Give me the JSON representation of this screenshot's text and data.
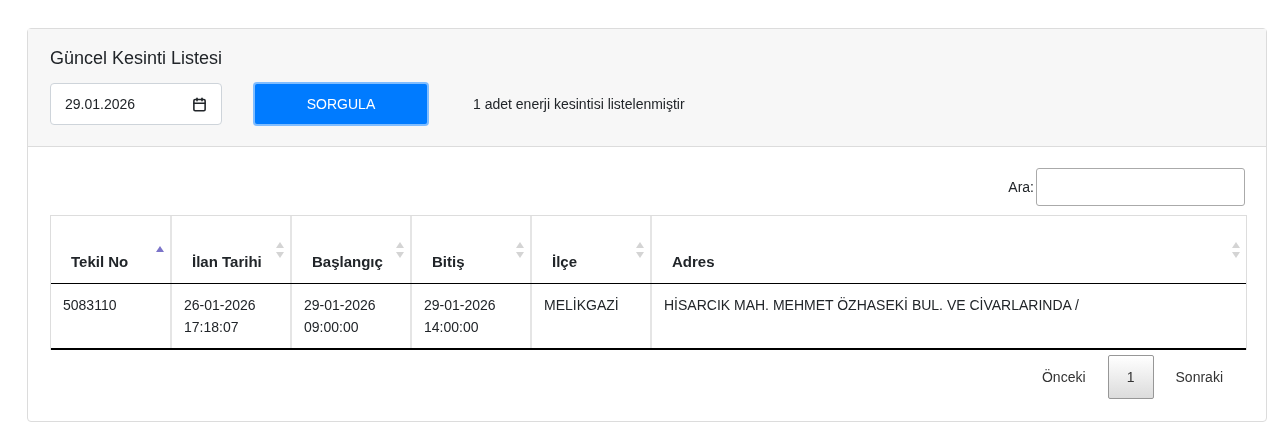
{
  "panel": {
    "title": "Güncel Kesinti Listesi",
    "date_value": "29.01.2026",
    "query_button": "SORGULA",
    "result_text": "1 adet enerji kesintisi listelenmiştir"
  },
  "search": {
    "label": "Ara:"
  },
  "table": {
    "columns": [
      {
        "label": "Tekil No",
        "sorted": true
      },
      {
        "label": "İlan Tarihi",
        "sorted": false
      },
      {
        "label": "Başlangıç",
        "sorted": false
      },
      {
        "label": "Bitiş",
        "sorted": false
      },
      {
        "label": "İlçe",
        "sorted": false
      },
      {
        "label": "Adres",
        "sorted": false
      }
    ],
    "rows": [
      {
        "cells": [
          [
            "5083110"
          ],
          [
            "26-01-2026",
            "17:18:07"
          ],
          [
            "29-01-2026",
            "09:00:00"
          ],
          [
            "29-01-2026",
            "14:00:00"
          ],
          [
            "MELİKGAZİ"
          ],
          [
            "HİSARCIK MAH. MEHMET ÖZHASEKİ BUL. VE CİVARLARINDA /"
          ]
        ]
      }
    ]
  },
  "pagination": {
    "previous": "Önceki",
    "pages": [
      {
        "label": "1",
        "selected": true
      }
    ],
    "next": "Sonraki"
  }
}
